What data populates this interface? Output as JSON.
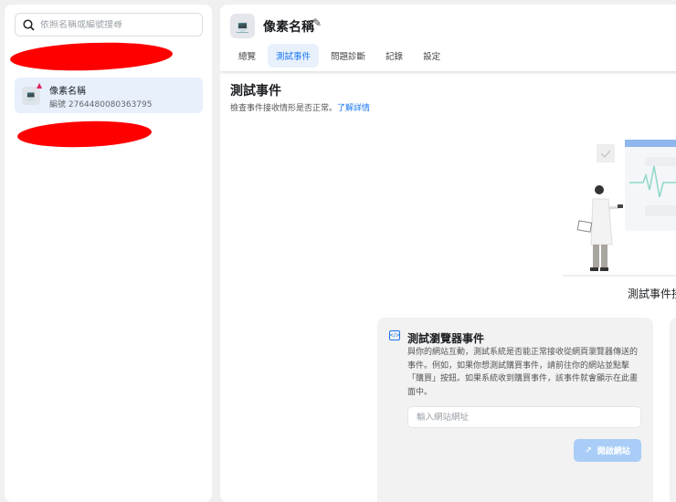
{
  "sidebar": {
    "search_placeholder": "依照名稱或編號搜尋",
    "items": [
      {
        "name": "像素名稱",
        "id": "編號 2764480080363795",
        "warning": "▲"
      }
    ]
  },
  "header": {
    "title": "像素名稱",
    "tabs": [
      "總覽",
      "測試事件",
      "問題診斷",
      "記錄",
      "設定"
    ],
    "active_tab": 1
  },
  "main": {
    "heading": "測試事件",
    "subtitle": "檢查事件接收情形是否正常。",
    "learn_more": "了解詳情",
    "illustration_caption": "測試事件接收",
    "browser_card": {
      "title": "測試瀏覽器事件",
      "description": "與你的網站互動，測試系統是否能正常接收從網頁瀏覽器傳送的事件。例如，如果你想測試購買事件，請前往你的網站並點擊「購買」按鈕。如果系統收到購買事件，該事件就會顯示在此畫面中。",
      "url_placeholder": "輸入網站網址",
      "open_button": "開啟網站"
    }
  },
  "colors": {
    "accent": "#1877f2",
    "redaction": "#ff0000"
  }
}
